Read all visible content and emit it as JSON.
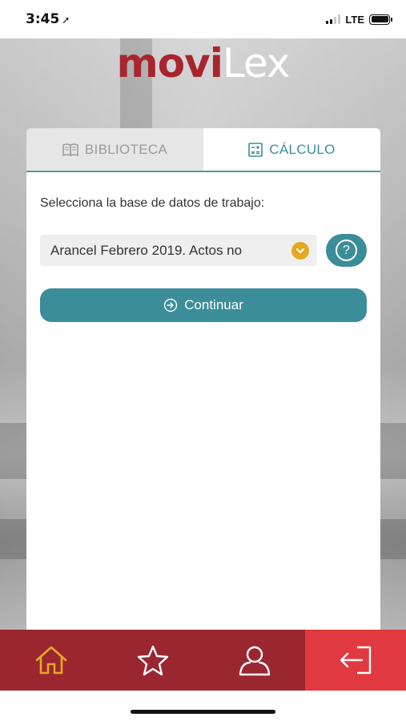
{
  "status_bar": {
    "time": "3:45",
    "network": "LTE"
  },
  "logo": {
    "part1": "movi",
    "part2": "Lex"
  },
  "tabs": [
    {
      "label": "BIBLIOTECA",
      "icon": "book-icon",
      "active": false
    },
    {
      "label": "CÁLCULO",
      "icon": "calculator-icon",
      "active": true
    }
  ],
  "form": {
    "prompt": "Selecciona la base de datos de trabajo:",
    "database_selected": "Arancel Febrero 2019. Actos no",
    "help_symbol": "?",
    "continue_label": "Continuar"
  },
  "bottom_nav": [
    {
      "name": "home",
      "icon": "home-icon",
      "active": true
    },
    {
      "name": "favorites",
      "icon": "star-icon",
      "active": false
    },
    {
      "name": "profile",
      "icon": "user-icon",
      "active": false
    },
    {
      "name": "logout",
      "icon": "logout-icon",
      "active": false
    }
  ],
  "colors": {
    "brand_red": "#a8252f",
    "nav_red": "#9a2630",
    "exit_red": "#e0393f",
    "teal": "#3b8d99",
    "accent_yellow": "#e5a823"
  }
}
